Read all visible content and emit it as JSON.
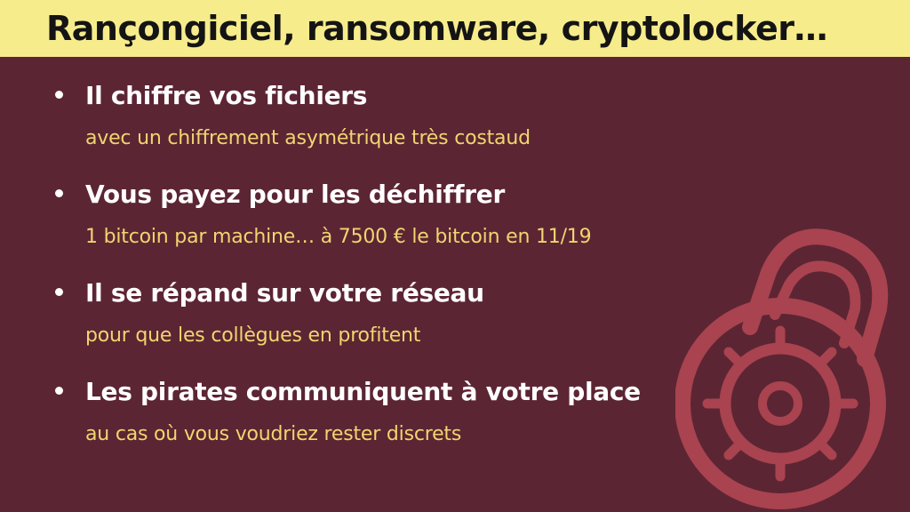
{
  "slide": {
    "title": "Rançongiciel, ransomware, cryptolocker…",
    "bullets": [
      {
        "main": "Il chiffre vos fichiers",
        "sub": "avec un chiffrement asymétrique très costaud"
      },
      {
        "main": "Vous payez pour les déchiffrer",
        "sub": "1 bitcoin par machine… à 7500 € le bitcoin en 11/19"
      },
      {
        "main": "Il se répand sur votre réseau",
        "sub": "pour que les collègues en profitent"
      },
      {
        "main": "Les pirates communiquent à votre place",
        "sub": "au cas où vous voudriez rester discrets"
      }
    ],
    "illustration_icon": "combination-lock-icon"
  },
  "colors": {
    "background": "#5c2533",
    "title_bar": "#f7ec8c",
    "title_text": "#141414",
    "main_text": "#ffffff",
    "sub_text": "#f0d571",
    "lock": "#a8434f"
  }
}
